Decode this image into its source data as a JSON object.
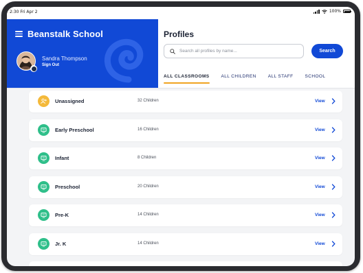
{
  "status_bar": {
    "time": "2:30  Fri Apr 2",
    "battery": "100%"
  },
  "sidebar": {
    "school_name": "Beanstalk School",
    "user_name": "Sandra Thompson",
    "sign_out": "Sign Out"
  },
  "profiles": {
    "title": "Profiles",
    "search_placeholder": "Search all profiles by name...",
    "search_button": "Search",
    "tabs": [
      {
        "label": "ALL CLASSROOMS",
        "active": true
      },
      {
        "label": "ALL CHILDREN",
        "active": false
      },
      {
        "label": "ALL STAFF",
        "active": false
      },
      {
        "label": "SCHOOL",
        "active": false
      }
    ]
  },
  "classrooms": [
    {
      "name": "Unassigned",
      "count": "32 Children",
      "view": "View",
      "icon": "unassigned-user-icon",
      "color": "#f4b93a"
    },
    {
      "name": "Early Preschool",
      "count": "16 Children",
      "view": "View",
      "icon": "classroom-board-icon",
      "color": "#2fbf8a"
    },
    {
      "name": "Infant",
      "count": "8 Children",
      "view": "View",
      "icon": "classroom-board-icon",
      "color": "#2fbf8a"
    },
    {
      "name": "Preschool",
      "count": "20 Children",
      "view": "View",
      "icon": "classroom-board-icon",
      "color": "#2fbf8a"
    },
    {
      "name": "Pre-K",
      "count": "14 Children",
      "view": "View",
      "icon": "classroom-board-icon",
      "color": "#2fbf8a"
    },
    {
      "name": "Jr. K",
      "count": "14 Children",
      "view": "View",
      "icon": "classroom-board-icon",
      "color": "#2fbf8a"
    }
  ],
  "colors": {
    "brand_blue": "#1149d6",
    "tab_underline": "#f0a320",
    "background": "#f3f4f6"
  }
}
